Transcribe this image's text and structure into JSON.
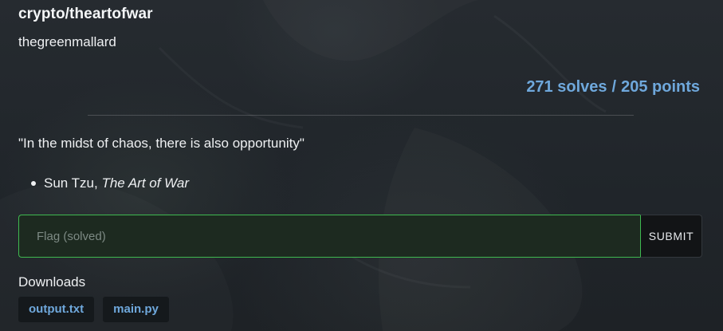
{
  "challenge": {
    "title": "crypto/theartofwar",
    "author": "thegreenmallard",
    "solves": "271 solves",
    "separator": "/",
    "points": "205 points"
  },
  "description": {
    "quote": "\"In the midst of chaos, there is also opportunity\"",
    "attribution_name": "Sun Tzu, ",
    "attribution_work": "The Art of War"
  },
  "flag": {
    "value": "",
    "placeholder": "Flag (solved)",
    "submit_label": "SUBMIT"
  },
  "downloads": {
    "label": "Downloads",
    "files": [
      {
        "name": "output.txt"
      },
      {
        "name": "main.py"
      }
    ]
  },
  "colors": {
    "accent": "#6fa8dc",
    "success_border": "#3fb950",
    "background": "#22272c"
  }
}
